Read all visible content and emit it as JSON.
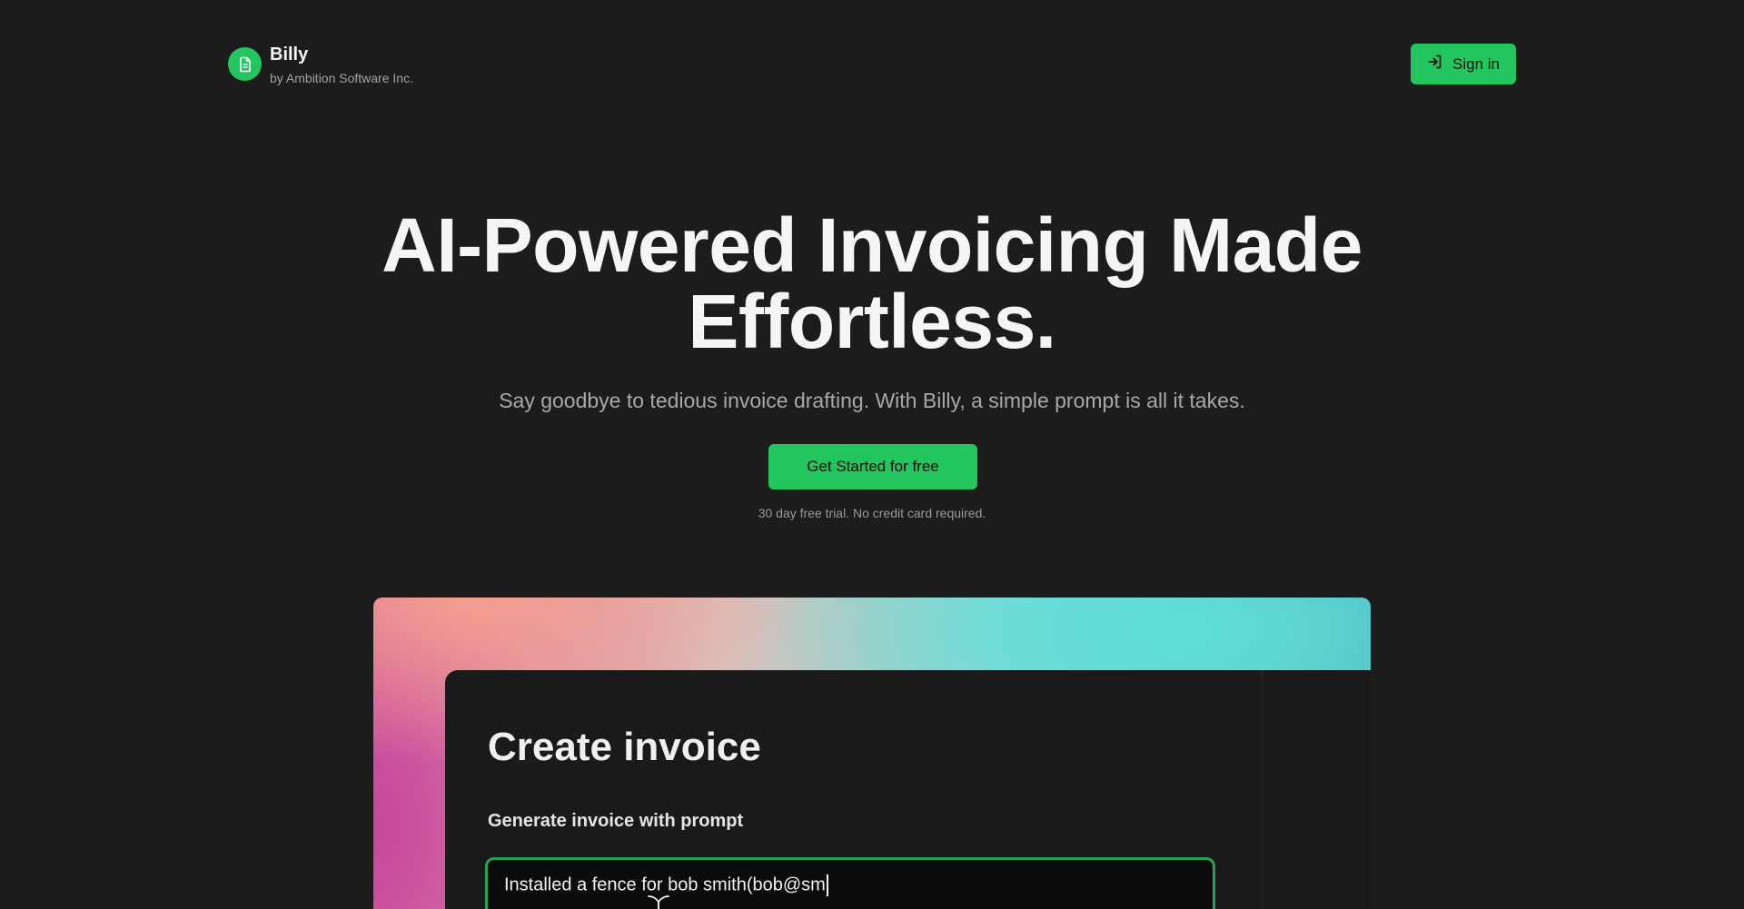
{
  "header": {
    "brand_name": "Billy",
    "brand_sub": "by Ambition Software Inc.",
    "logo_icon": "document-icon",
    "signin_label": "Sign in",
    "signin_icon": "sign-in-icon"
  },
  "hero": {
    "title_line1": "AI-Powered Invoicing Made",
    "title_line2": "Effortless.",
    "subtitle": "Say goodbye to tedious invoice drafting. With Billy, a simple prompt is all it takes.",
    "cta_label": "Get Started for free",
    "trial_note": "30 day free trial. No credit card required."
  },
  "preview": {
    "card_title": "Create invoice",
    "prompt_label": "Generate invoice with prompt",
    "prompt_value": "Installed a fence for bob smith(bob@sm"
  },
  "colors": {
    "background": "#1c1c1c",
    "accent": "#22c55e",
    "text": "#f5f5f5",
    "muted": "#a3a3a3"
  }
}
